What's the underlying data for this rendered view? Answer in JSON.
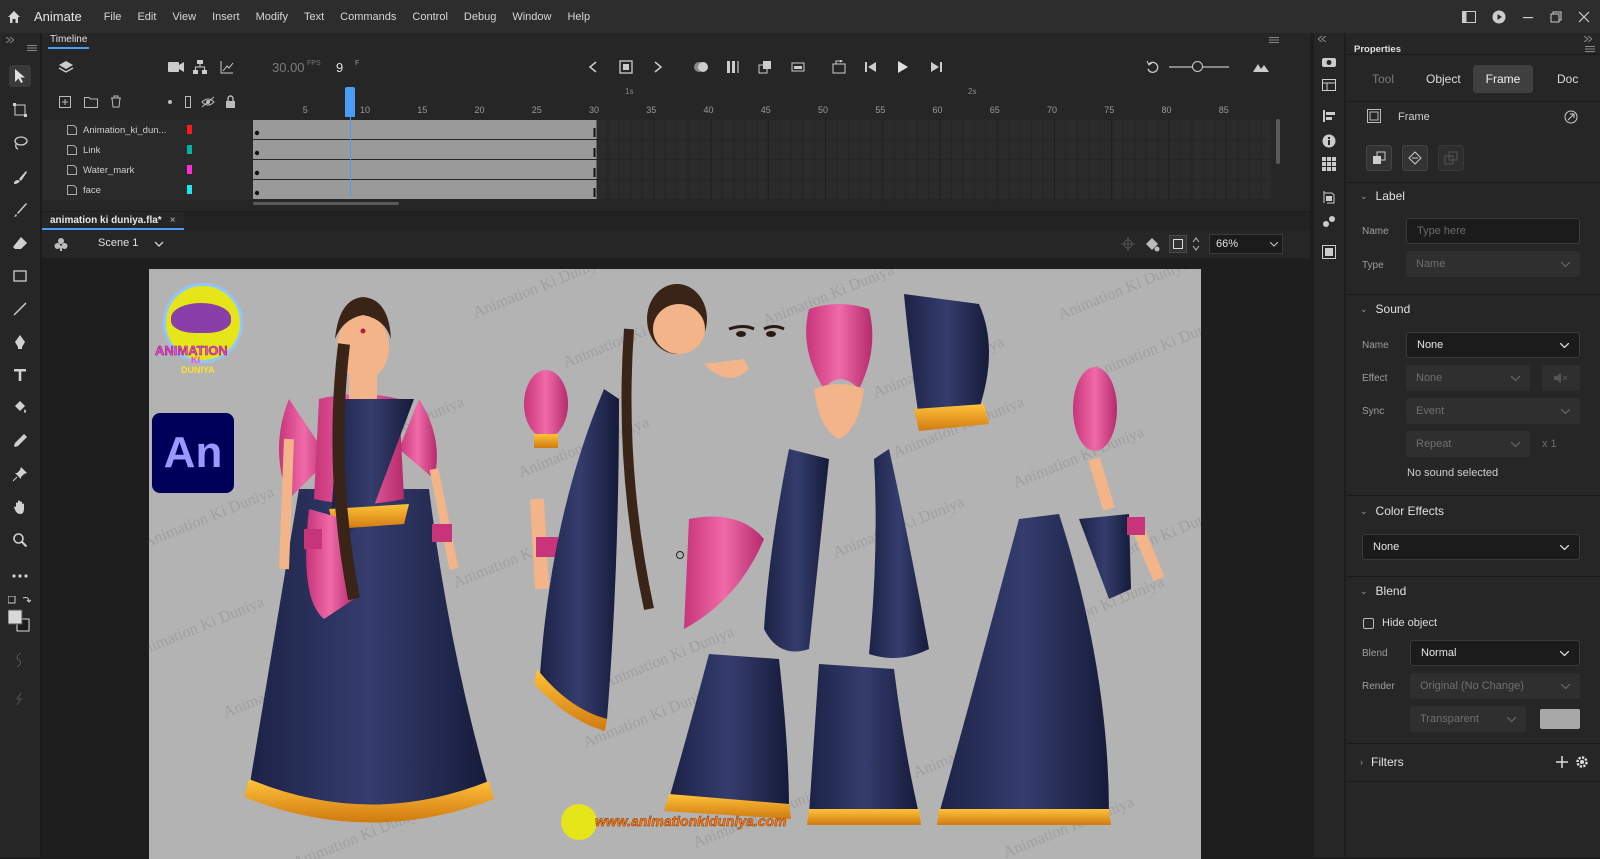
{
  "app": {
    "name": "Animate"
  },
  "menu": [
    "File",
    "Edit",
    "View",
    "Insert",
    "Modify",
    "Text",
    "Commands",
    "Control",
    "Debug",
    "Window",
    "Help"
  ],
  "timeline": {
    "tab": "Timeline",
    "fps": "30.00",
    "fps_unit": "FPS",
    "frame": "9",
    "frame_unit": "F",
    "ruler_seconds": [
      "1s",
      "2s"
    ],
    "ruler_numbers": [
      "5",
      "10",
      "15",
      "20",
      "25",
      "30",
      "35",
      "40",
      "45",
      "50",
      "55",
      "60",
      "65",
      "70",
      "75",
      "80",
      "85"
    ],
    "current_frame": 9,
    "span_frames": 30,
    "layers": [
      {
        "name": "Animation_ki_dun...",
        "color": "#ff1a1a"
      },
      {
        "name": "Link",
        "color": "#00b3a6"
      },
      {
        "name": "Water_mark",
        "color": "#ff2ad4"
      },
      {
        "name": "face",
        "color": "#19e6f0"
      }
    ]
  },
  "document": {
    "tab": "animation ki duniya.fla*",
    "scene": "Scene 1",
    "zoom": "66%"
  },
  "stage": {
    "watermark": "Animation Ki Duniya",
    "logo_lines": [
      "ANIMATION",
      "KI",
      "DUNIYA"
    ],
    "an_badge": "An",
    "site": "www.animationkiduniya.com"
  },
  "properties": {
    "title": "Properties",
    "tabs": [
      "Tool",
      "Object",
      "Frame",
      "Doc"
    ],
    "active_tab": "Frame",
    "frame_label": "Frame",
    "label_section": {
      "title": "Label",
      "name_label": "Name",
      "name_placeholder": "Type here",
      "type_label": "Type",
      "type_value": "Name"
    },
    "sound_section": {
      "title": "Sound",
      "name_label": "Name",
      "name_value": "None",
      "effect_label": "Effect",
      "effect_value": "None",
      "sync_label": "Sync",
      "sync_value": "Event",
      "repeat_value": "Repeat",
      "repeat_count": "x 1",
      "status": "No sound selected"
    },
    "color_section": {
      "title": "Color Effects",
      "value": "None"
    },
    "blend_section": {
      "title": "Blend",
      "hide_label": "Hide object",
      "blend_label": "Blend",
      "blend_value": "Normal",
      "render_label": "Render",
      "render_value": "Original (No Change)",
      "transparent_value": "Transparent"
    },
    "filters_section": {
      "title": "Filters"
    }
  }
}
